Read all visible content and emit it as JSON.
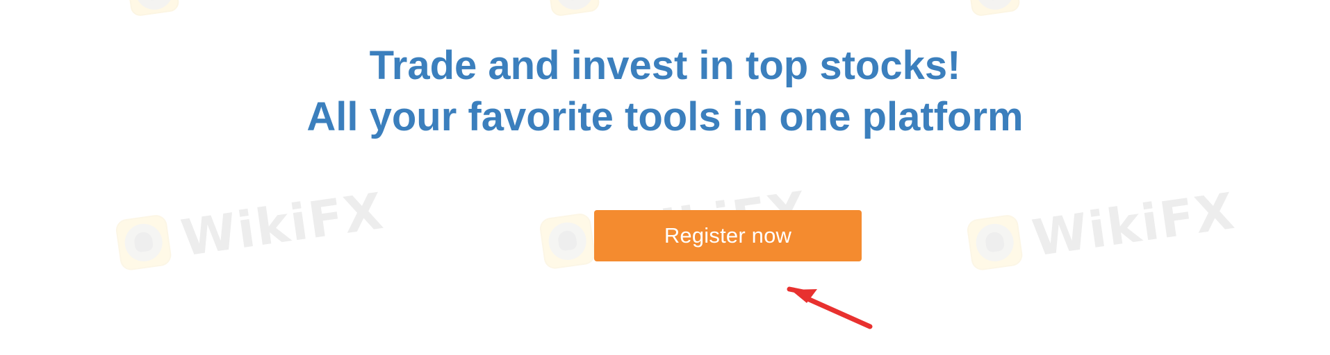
{
  "headline": {
    "line1": "Trade and invest in top stocks!",
    "line2": "All your favorite tools in one platform"
  },
  "cta": {
    "label": "Register now"
  },
  "watermark": {
    "text": "WikiFX",
    "icon": "wikifx-logo-icon"
  },
  "colors": {
    "headline": "#3b7fbd",
    "button": "#f48b2f",
    "button_text": "#ffffff",
    "arrow": "#e8312f",
    "watermark": "#d9d9d9",
    "watermark_logo_bg": "#fff2cc"
  }
}
